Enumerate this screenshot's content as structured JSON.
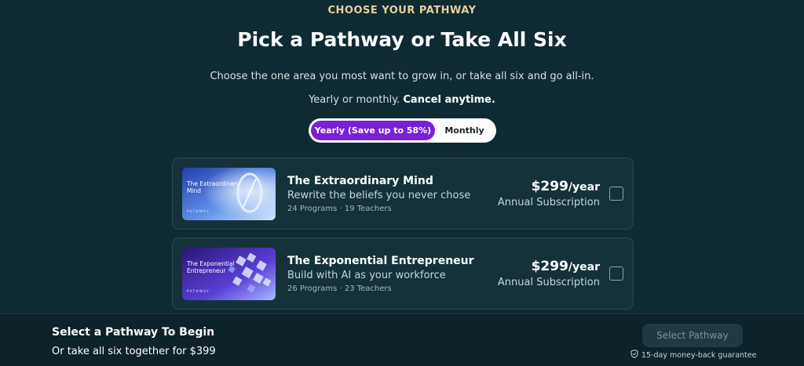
{
  "header": {
    "eyebrow": "CHOOSE YOUR PATHWAY",
    "title": "Pick a Pathway or Take All Six",
    "subtitle": "Choose the one area you most want to grow in, or take all six and go all-in.",
    "billing_prefix": "Yearly or monthly.",
    "billing_emphasis": "Cancel anytime."
  },
  "billing_toggle": {
    "yearly_label": "Yearly (Save up to 58%)",
    "monthly_label": "Monthly",
    "selected": "yearly"
  },
  "pathways": [
    {
      "thumb_text": "The Extraordinary Mind",
      "thumb_tag": "PATHWAY",
      "title": "The Extraordinary Mind",
      "description": "Rewrite the beliefs you never chose",
      "meta": "24 Programs · 19 Teachers",
      "price": "$299",
      "period": "/year",
      "subscription": "Annual Subscription",
      "checked": false
    },
    {
      "thumb_text": "The Exponential Entrepreneur",
      "thumb_tag": "PATHWAY",
      "title": "The Exponential Entrepreneur",
      "description": "Build with AI as your workforce",
      "meta": "26 Programs · 23 Teachers",
      "price": "$299",
      "period": "/year",
      "subscription": "Annual Subscription",
      "checked": false
    }
  ],
  "footer": {
    "title": "Select a Pathway To Begin",
    "subtitle": "Or take all six together for $399",
    "button_label": "Select Pathway",
    "guarantee": "15-day money-back guarantee"
  },
  "colors": {
    "background": "#0f2a33",
    "accent_purple": "#7b1fd6",
    "eyebrow_gold": "#e7cf9a"
  },
  "icons": {
    "guarantee": "shield-check-icon"
  }
}
